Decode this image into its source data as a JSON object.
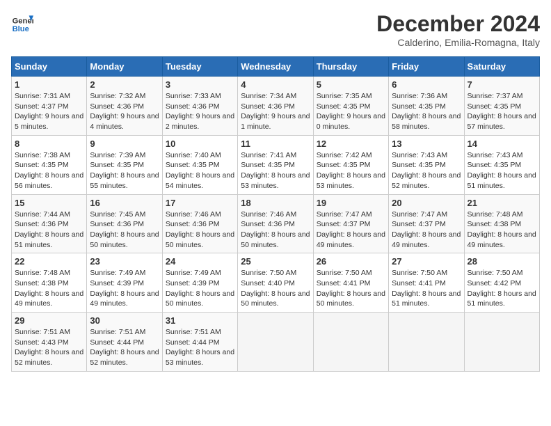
{
  "header": {
    "logo_text_general": "General",
    "logo_text_blue": "Blue",
    "month_title": "December 2024",
    "location": "Calderino, Emilia-Romagna, Italy"
  },
  "days_of_week": [
    "Sunday",
    "Monday",
    "Tuesday",
    "Wednesday",
    "Thursday",
    "Friday",
    "Saturday"
  ],
  "weeks": [
    [
      {
        "day": "1",
        "sunrise": "7:31 AM",
        "sunset": "4:37 PM",
        "daylight": "9 hours and 5 minutes."
      },
      {
        "day": "2",
        "sunrise": "7:32 AM",
        "sunset": "4:36 PM",
        "daylight": "9 hours and 4 minutes."
      },
      {
        "day": "3",
        "sunrise": "7:33 AM",
        "sunset": "4:36 PM",
        "daylight": "9 hours and 2 minutes."
      },
      {
        "day": "4",
        "sunrise": "7:34 AM",
        "sunset": "4:36 PM",
        "daylight": "9 hours and 1 minute."
      },
      {
        "day": "5",
        "sunrise": "7:35 AM",
        "sunset": "4:35 PM",
        "daylight": "9 hours and 0 minutes."
      },
      {
        "day": "6",
        "sunrise": "7:36 AM",
        "sunset": "4:35 PM",
        "daylight": "8 hours and 58 minutes."
      },
      {
        "day": "7",
        "sunrise": "7:37 AM",
        "sunset": "4:35 PM",
        "daylight": "8 hours and 57 minutes."
      }
    ],
    [
      {
        "day": "8",
        "sunrise": "7:38 AM",
        "sunset": "4:35 PM",
        "daylight": "8 hours and 56 minutes."
      },
      {
        "day": "9",
        "sunrise": "7:39 AM",
        "sunset": "4:35 PM",
        "daylight": "8 hours and 55 minutes."
      },
      {
        "day": "10",
        "sunrise": "7:40 AM",
        "sunset": "4:35 PM",
        "daylight": "8 hours and 54 minutes."
      },
      {
        "day": "11",
        "sunrise": "7:41 AM",
        "sunset": "4:35 PM",
        "daylight": "8 hours and 53 minutes."
      },
      {
        "day": "12",
        "sunrise": "7:42 AM",
        "sunset": "4:35 PM",
        "daylight": "8 hours and 53 minutes."
      },
      {
        "day": "13",
        "sunrise": "7:43 AM",
        "sunset": "4:35 PM",
        "daylight": "8 hours and 52 minutes."
      },
      {
        "day": "14",
        "sunrise": "7:43 AM",
        "sunset": "4:35 PM",
        "daylight": "8 hours and 51 minutes."
      }
    ],
    [
      {
        "day": "15",
        "sunrise": "7:44 AM",
        "sunset": "4:36 PM",
        "daylight": "8 hours and 51 minutes."
      },
      {
        "day": "16",
        "sunrise": "7:45 AM",
        "sunset": "4:36 PM",
        "daylight": "8 hours and 50 minutes."
      },
      {
        "day": "17",
        "sunrise": "7:46 AM",
        "sunset": "4:36 PM",
        "daylight": "8 hours and 50 minutes."
      },
      {
        "day": "18",
        "sunrise": "7:46 AM",
        "sunset": "4:36 PM",
        "daylight": "8 hours and 50 minutes."
      },
      {
        "day": "19",
        "sunrise": "7:47 AM",
        "sunset": "4:37 PM",
        "daylight": "8 hours and 49 minutes."
      },
      {
        "day": "20",
        "sunrise": "7:47 AM",
        "sunset": "4:37 PM",
        "daylight": "8 hours and 49 minutes."
      },
      {
        "day": "21",
        "sunrise": "7:48 AM",
        "sunset": "4:38 PM",
        "daylight": "8 hours and 49 minutes."
      }
    ],
    [
      {
        "day": "22",
        "sunrise": "7:48 AM",
        "sunset": "4:38 PM",
        "daylight": "8 hours and 49 minutes."
      },
      {
        "day": "23",
        "sunrise": "7:49 AM",
        "sunset": "4:39 PM",
        "daylight": "8 hours and 49 minutes."
      },
      {
        "day": "24",
        "sunrise": "7:49 AM",
        "sunset": "4:39 PM",
        "daylight": "8 hours and 50 minutes."
      },
      {
        "day": "25",
        "sunrise": "7:50 AM",
        "sunset": "4:40 PM",
        "daylight": "8 hours and 50 minutes."
      },
      {
        "day": "26",
        "sunrise": "7:50 AM",
        "sunset": "4:41 PM",
        "daylight": "8 hours and 50 minutes."
      },
      {
        "day": "27",
        "sunrise": "7:50 AM",
        "sunset": "4:41 PM",
        "daylight": "8 hours and 51 minutes."
      },
      {
        "day": "28",
        "sunrise": "7:50 AM",
        "sunset": "4:42 PM",
        "daylight": "8 hours and 51 minutes."
      }
    ],
    [
      {
        "day": "29",
        "sunrise": "7:51 AM",
        "sunset": "4:43 PM",
        "daylight": "8 hours and 52 minutes."
      },
      {
        "day": "30",
        "sunrise": "7:51 AM",
        "sunset": "4:44 PM",
        "daylight": "8 hours and 52 minutes."
      },
      {
        "day": "31",
        "sunrise": "7:51 AM",
        "sunset": "4:44 PM",
        "daylight": "8 hours and 53 minutes."
      },
      null,
      null,
      null,
      null
    ]
  ]
}
